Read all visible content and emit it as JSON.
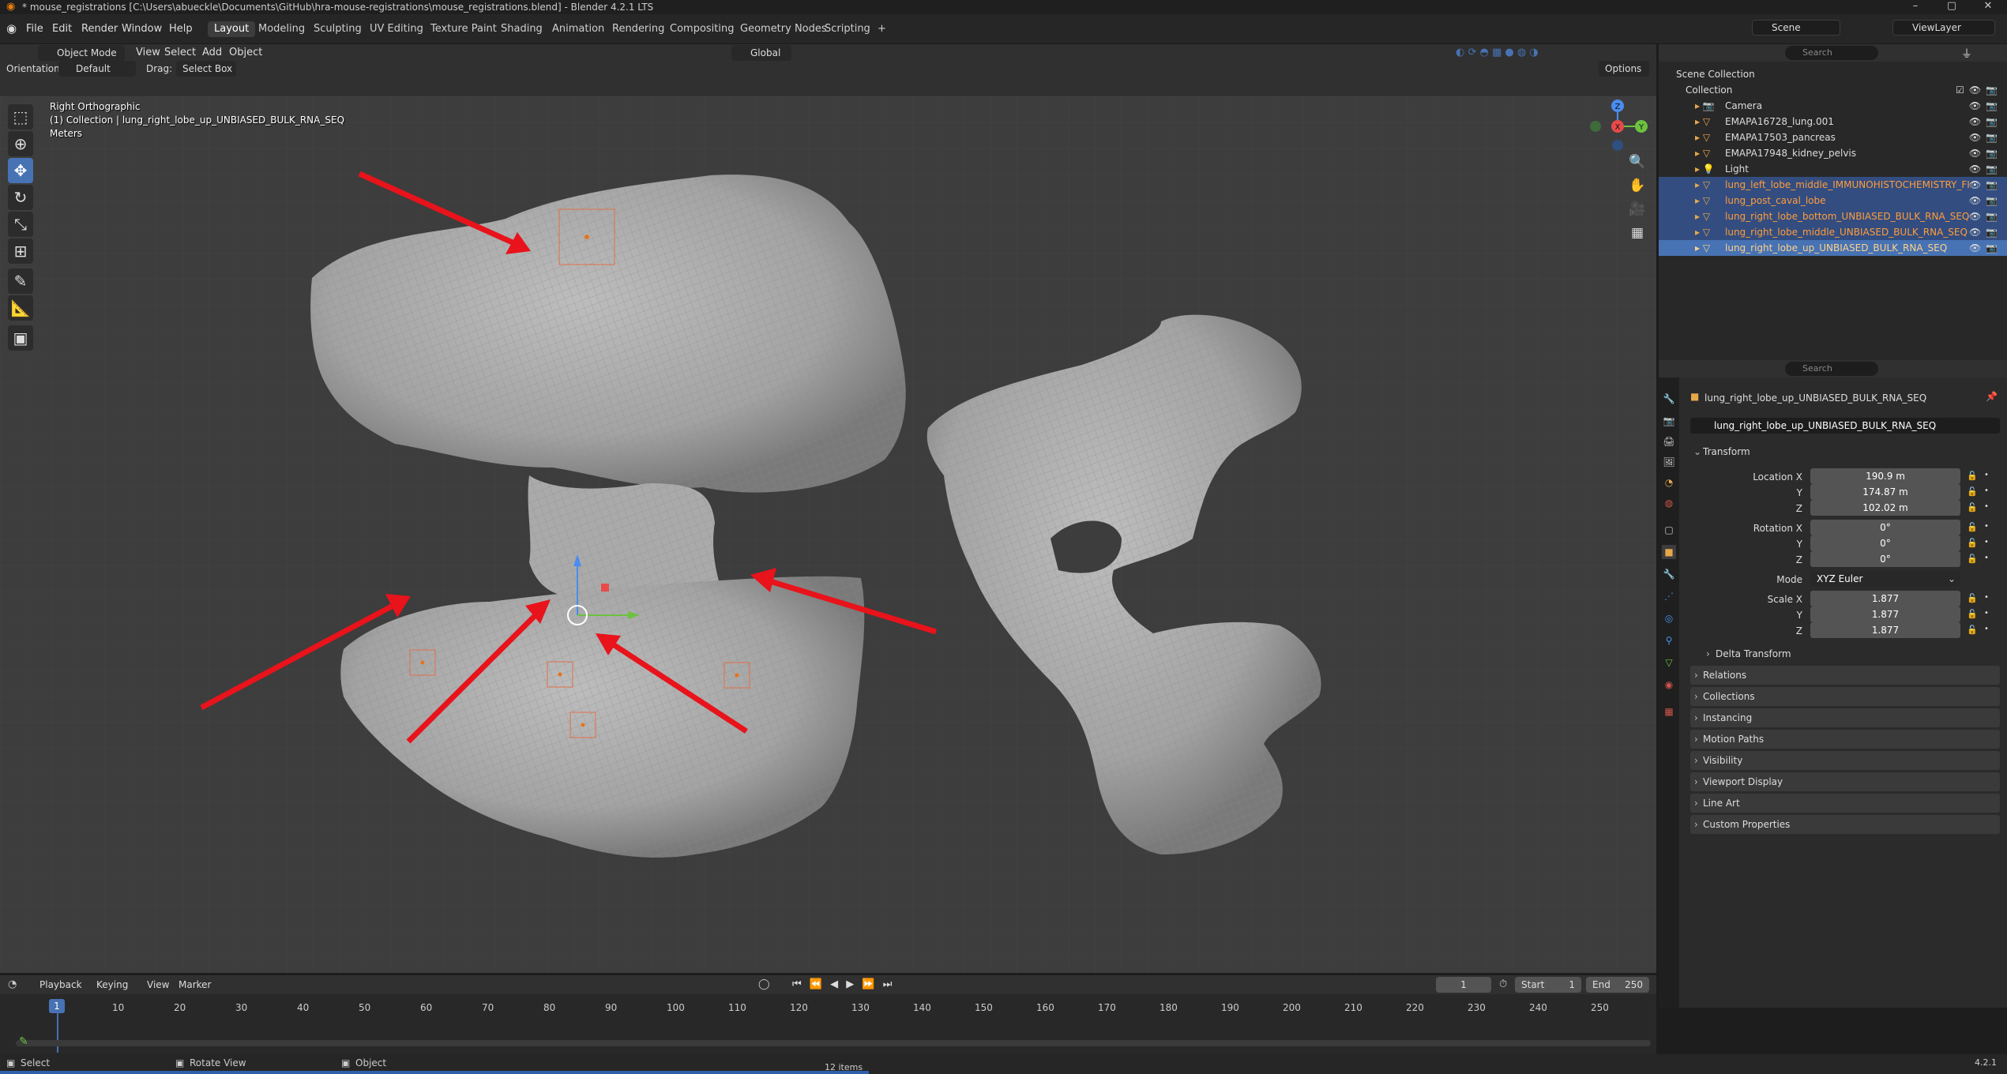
{
  "window": {
    "title": "* mouse_registrations [C:\\Users\\abueckle\\Documents\\GitHub\\hra-mouse-registrations\\mouse_registrations.blend] - Blender 4.2.1 LTS"
  },
  "menu": [
    "File",
    "Edit",
    "Render",
    "Window",
    "Help"
  ],
  "workspaces": [
    "Layout",
    "Modeling",
    "Sculpting",
    "UV Editing",
    "Texture Paint",
    "Shading",
    "Animation",
    "Rendering",
    "Compositing",
    "Geometry Nodes",
    "Scripting",
    "+"
  ],
  "topright": {
    "scene": "Scene",
    "viewlayer": "ViewLayer"
  },
  "header": {
    "mode": "Object Mode",
    "view": "View",
    "select": "Select",
    "add": "Add",
    "object": "Object",
    "transform": "Global",
    "orientation_label": "Orientation:",
    "orientation_value": "Default",
    "drag_label": "Drag:",
    "drag_value": "Select Box",
    "options": "Options"
  },
  "viewport": {
    "view_name": "Right Orthographic",
    "collection_line": "(1) Collection | lung_right_lobe_up_UNBIASED_BULK_RNA_SEQ",
    "units": "Meters",
    "gizmo": {
      "z": "Z",
      "y": "Y",
      "x": "X"
    }
  },
  "outliner": {
    "search_placeholder": "Search",
    "scene_collection": "Scene Collection",
    "collection": "Collection",
    "items": [
      {
        "name": "Camera",
        "type": "camera",
        "selected": false
      },
      {
        "name": "EMAPA16728_lung.001",
        "type": "mesh",
        "selected": false
      },
      {
        "name": "EMAPA17503_pancreas",
        "type": "mesh",
        "selected": false
      },
      {
        "name": "EMAPA17948_kidney_pelvis",
        "type": "mesh",
        "selected": false
      },
      {
        "name": "Light",
        "type": "light",
        "selected": false
      },
      {
        "name": "lung_left_lobe_middle_IMMUNOHISTOCHEMISTRY_FI",
        "type": "mesh",
        "selected": true
      },
      {
        "name": "lung_post_caval_lobe",
        "type": "mesh",
        "selected": true
      },
      {
        "name": "lung_right_lobe_bottom_UNBIASED_BULK_RNA_SEQ",
        "type": "mesh",
        "selected": true
      },
      {
        "name": "lung_right_lobe_middle_UNBIASED_BULK_RNA_SEQ",
        "type": "mesh",
        "selected": true
      },
      {
        "name": "lung_right_lobe_up_UNBIASED_BULK_RNA_SEQ",
        "type": "mesh",
        "selected": true,
        "active": true
      }
    ]
  },
  "properties": {
    "search_placeholder": "Search",
    "object_name": "lung_right_lobe_up_UNBIASED_BULK_RNA_SEQ",
    "object_field": "lung_right_lobe_up_UNBIASED_BULK_RNA_SEQ",
    "transform_label": "Transform",
    "location": {
      "label": "Location X",
      "x": "190.9 m",
      "y": "174.87 m",
      "z": "102.02 m"
    },
    "rotation": {
      "label": "Rotation X",
      "x": "0°",
      "y": "0°",
      "z": "0°"
    },
    "mode": {
      "label": "Mode",
      "value": "XYZ Euler"
    },
    "scale": {
      "label": "Scale X",
      "x": "1.877",
      "y": "1.877",
      "z": "1.877"
    },
    "axis": {
      "y": "Y",
      "z": "Z"
    },
    "delta": "Delta Transform",
    "panels": [
      "Relations",
      "Collections",
      "Instancing",
      "Motion Paths",
      "Visibility",
      "Viewport Display",
      "Line Art",
      "Custom Properties"
    ]
  },
  "timeline": {
    "menus": [
      "Playback",
      "Keying",
      "View",
      "Marker"
    ],
    "current_frame": "1",
    "start_label": "Start",
    "start": "1",
    "end_label": "End",
    "end": "250",
    "ticks": [
      "10",
      "20",
      "30",
      "40",
      "50",
      "60",
      "70",
      "80",
      "90",
      "100",
      "110",
      "120",
      "130",
      "140",
      "150",
      "160",
      "170",
      "180",
      "190",
      "200",
      "210",
      "220",
      "230",
      "240",
      "250"
    ],
    "playhead": "1"
  },
  "statusbar": {
    "select": "Select",
    "rotate": "Rotate View",
    "object": "Object",
    "items": "12 items",
    "version": "4.2.1"
  },
  "colors": {
    "accent": "#4772b3",
    "selected_text": "#ff9d3b",
    "arrow": "#e8131b"
  }
}
